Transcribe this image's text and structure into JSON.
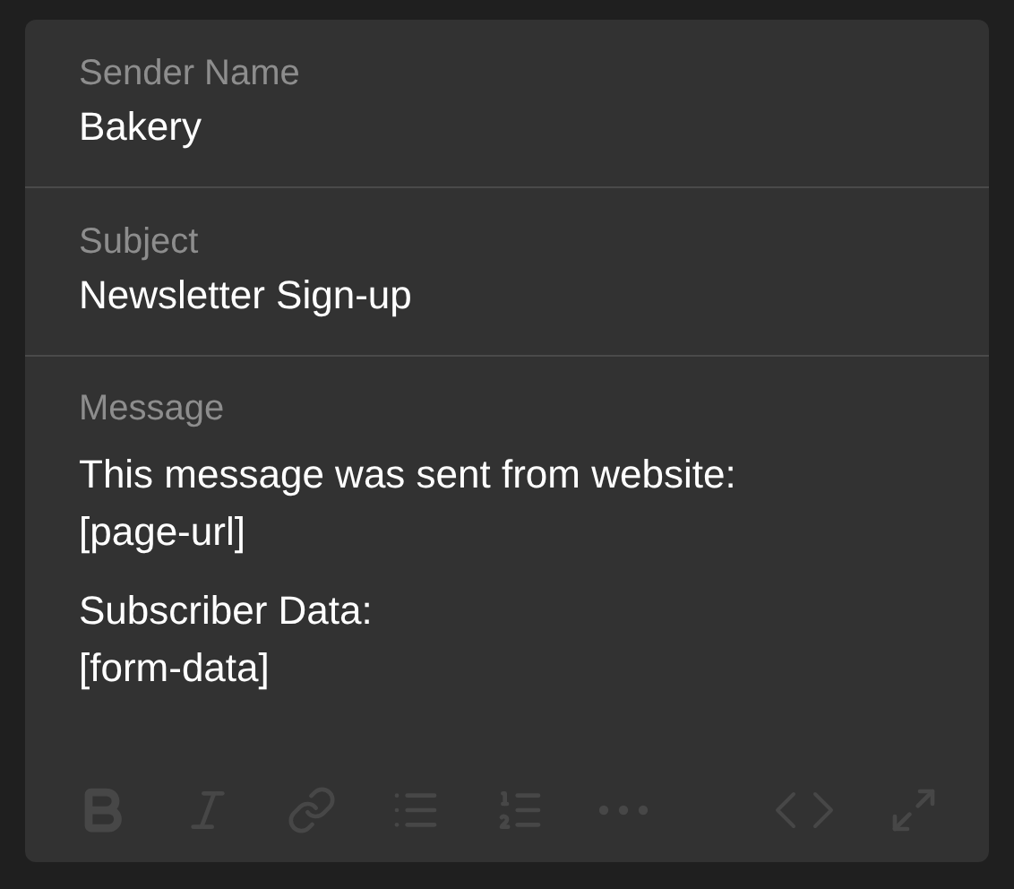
{
  "fields": [
    {
      "label": "Sender Name",
      "value": "Bakery"
    },
    {
      "label": "Subject",
      "value": "Newsletter Sign-up"
    }
  ],
  "message": {
    "label": "Message",
    "paragraphs": [
      [
        "This message was sent from website:",
        "[page-url]"
      ],
      [
        "Subscriber Data:",
        "[form-data]"
      ]
    ]
  },
  "toolbar": {
    "disabled": true,
    "tools": [
      {
        "kind": "bold"
      },
      {
        "kind": "italic"
      },
      {
        "kind": "link"
      },
      {
        "kind": "bullet-list"
      },
      {
        "kind": "numbered-list"
      },
      {
        "kind": "more"
      },
      {
        "kind": "spacer"
      },
      {
        "kind": "code"
      },
      {
        "kind": "expand"
      }
    ]
  }
}
